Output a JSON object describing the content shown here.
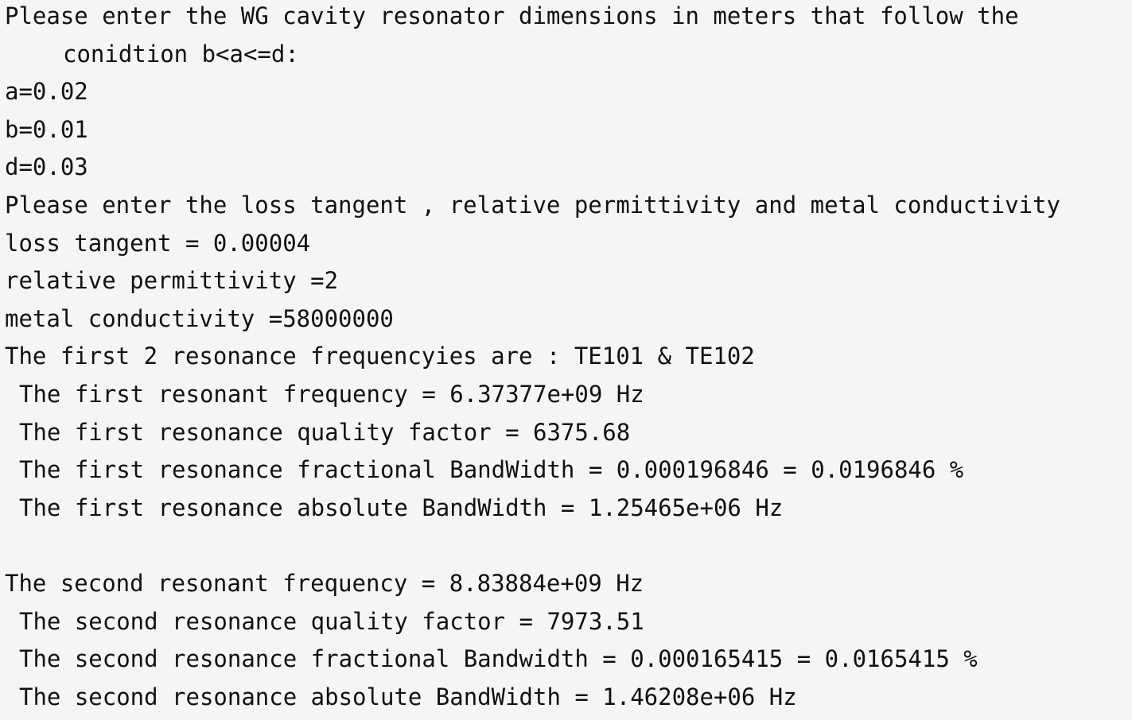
{
  "console": {
    "prompt_dimensions_line1": "Please enter the WG cavity resonator dimensions in meters that follow the",
    "prompt_dimensions_line2": "conidtion b<a<=d:",
    "input_a": "a=0.02",
    "input_b": "b=0.01",
    "input_d": "d=0.03",
    "prompt_material": "Please enter the loss tangent , relative permittivity and metal conductivity",
    "input_loss_tangent": "loss tangent = 0.00004",
    "input_permittivity": "relative permittivity =2",
    "input_conductivity": "metal conductivity =58000000",
    "modes_line": "The first 2 resonance frequencyies are : TE101 & TE102",
    "first_freq": "The first resonant frequency = 6.37377e+09 Hz",
    "first_q": "The first resonance quality factor = 6375.68",
    "first_frac_bw": "The first resonance fractional BandWidth = 0.000196846 = 0.0196846 %",
    "first_abs_bw": "The first resonance absolute BandWidth = 1.25465e+06 Hz",
    "second_freq": "The second resonant frequency = 8.83884e+09 Hz",
    "second_q": "The second resonance quality factor = 7973.51",
    "second_frac_bw": "The second resonance fractional Bandwidth = 0.000165415 = 0.0165415 %",
    "second_abs_bw": "The second resonance absolute BandWidth = 1.46208e+06 Hz"
  }
}
